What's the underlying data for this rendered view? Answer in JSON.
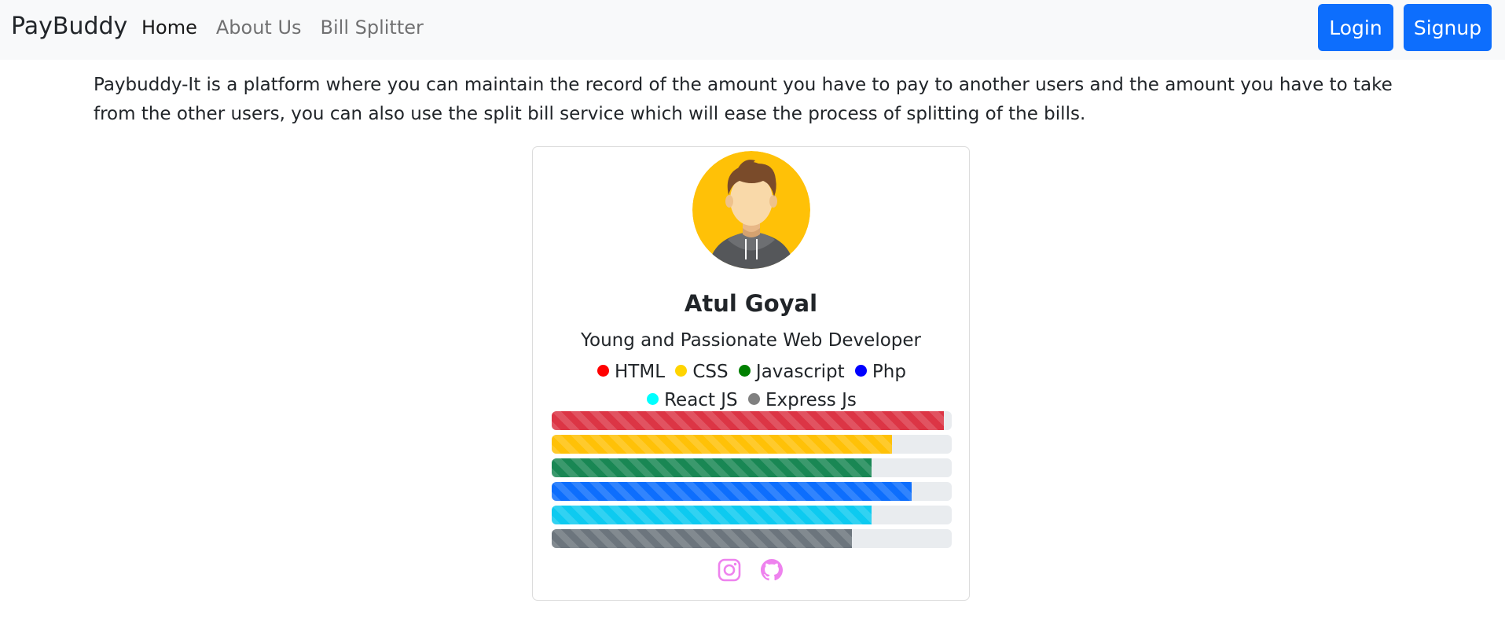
{
  "navbar": {
    "brand": "PayBuddy",
    "links": [
      "Home",
      "About Us",
      "Bill Splitter"
    ],
    "login_label": "Login",
    "signup_label": "Signup"
  },
  "intro": "Paybuddy-It is a platform where you can maintain the record of the amount you have to pay to another users and the amount you have to take from the other users, you can also use the split bill service which will ease the process of splitting of the bills.",
  "profile": {
    "name": "Atul Goyal",
    "tagline": "Young and Passionate Web Developer",
    "skills": [
      {
        "label": "HTML",
        "dot_color": "#ff0000",
        "bar_color": "#dc3545",
        "level": 0.98
      },
      {
        "label": "CSS",
        "dot_color": "#ffd400",
        "bar_color": "#ffc107",
        "level": 0.85
      },
      {
        "label": "Javascript",
        "dot_color": "#008000",
        "bar_color": "#198754",
        "level": 0.8
      },
      {
        "label": "Php",
        "dot_color": "#0000ff",
        "bar_color": "#0d6efd",
        "level": 0.9
      },
      {
        "label": "React JS",
        "dot_color": "#00ffff",
        "bar_color": "#0dcaf0",
        "level": 0.8
      },
      {
        "label": "Express Js",
        "dot_color": "#808080",
        "bar_color": "#6c757d",
        "level": 0.75
      }
    ],
    "social_icons": [
      "instagram-icon",
      "github-icon"
    ],
    "social_color": "#ee82ee"
  },
  "colors": {
    "accent": "#0d6efd",
    "avatar_bg": "#ffc107"
  }
}
